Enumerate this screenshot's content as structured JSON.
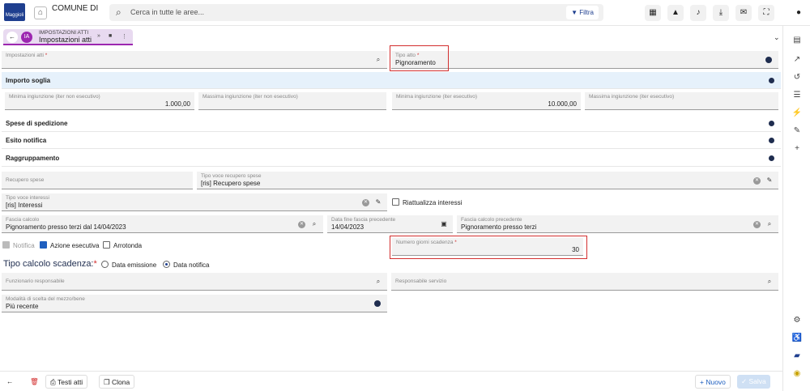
{
  "header": {
    "logo_text": "Maggioli",
    "comune_label": "COMUNE DI",
    "search_placeholder": "Cerca in tutte le aree...",
    "filter_label": "Filtra",
    "toolbar_icons": [
      "grid-icon",
      "warning-icon",
      "bell-icon",
      "download-icon",
      "mail-icon",
      "fullscreen-icon",
      "account-icon"
    ]
  },
  "tab": {
    "subtitle": "IMPOSTAZIONI ATTI",
    "title": "Impostazioni atti",
    "badge": "IA"
  },
  "form": {
    "impostazioni_label": "Impostazioni atti",
    "impostazioni_value": "",
    "tipo_atto_label": "Tipo atto",
    "tipo_atto_value": "Pignoramento",
    "importo_soglia": "Importo soglia",
    "min_ing_non_esec_label": "Minima ingiunzione (iter non esecutivo)",
    "min_ing_non_esec_value": "1.000,00",
    "max_ing_non_esec_label": "Massima ingiunzione (iter non esecutivo)",
    "max_ing_non_esec_value": "",
    "min_ing_esec_label": "Minima ingiunzione (iter esecutivo)",
    "min_ing_esec_value": "10.000,00",
    "max_ing_esec_label": "Massima ingiunzione (iter esecutivo)",
    "max_ing_esec_value": "",
    "spese_spedizione": "Spese di spedizione",
    "esito_notifica": "Esito notifica",
    "raggruppamento": "Raggruppamento",
    "recupero_spese_label": "Recupero spese",
    "tipo_voce_recupero_label": "Tipo voce recupero spese",
    "tipo_voce_recupero_value": "[ris] Recupero spese",
    "tipo_voce_interessi_label": "Tipo voce interessi",
    "tipo_voce_interessi_value": "[ris] Interessi",
    "riattualizza_label": "Riattualizza interessi",
    "fascia_calcolo_label": "Fascia calcolo",
    "fascia_calcolo_value": "Pignoramento presso terzi dal 14/04/2023",
    "data_fine_label": "Data fine fascia precedente",
    "data_fine_value": "14/04/2023",
    "fascia_prec_label": "Fascia calcolo precedente",
    "fascia_prec_value": "Pignoramento presso terzi",
    "notifica_label": "Notifica",
    "azione_esecutiva_label": "Azione esecutiva",
    "arrotonda_label": "Arrotonda",
    "numero_giorni_label": "Numero giorni scadenza",
    "numero_giorni_value": "30",
    "tipo_calcolo_label": "Tipo calcolo scadenza:",
    "data_emissione_label": "Data emissione",
    "data_notifica_label": "Data notifica",
    "funzionario_label": "Funzionario responsabile",
    "responsabile_label": "Responsabile servizio",
    "modalita_label": "Modalità di scelta del mezzo/bene",
    "modalita_value": "Più recente"
  },
  "footer": {
    "testi_atti": "Testi atti",
    "clona": "Clona",
    "nuovo": "+ Nuovo",
    "salva": "Salva"
  },
  "colors": {
    "accent": "#9c27b0",
    "primary": "#1f3f8f",
    "highlight": "#d32f2f"
  }
}
